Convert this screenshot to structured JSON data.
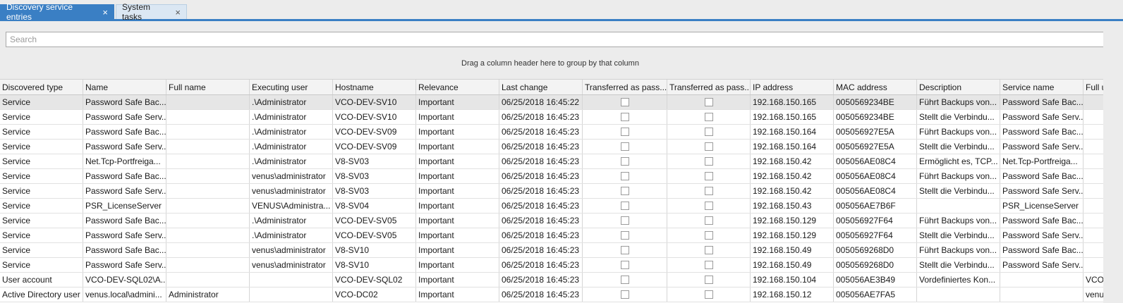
{
  "tabs": [
    {
      "label": "Discovery service entries",
      "close": "×"
    },
    {
      "label": "System tasks",
      "close": "×"
    }
  ],
  "search": {
    "placeholder": "Search",
    "value": ""
  },
  "group_hint": "Drag a column header here to group by that column",
  "columns": [
    "Discovered type",
    "Name",
    "Full name",
    "Executing user",
    "Hostname",
    "Relevance",
    "Last change",
    "Transferred as pass...",
    "Transferred as pass...",
    "IP address",
    "MAC address",
    "Description",
    "Service name",
    "Full u"
  ],
  "rows": [
    [
      "Service",
      "Password Safe Bac...",
      "",
      ".\\Administrator",
      "VCO-DEV-SV10",
      "Important",
      "06/25/2018 16:45:22",
      false,
      false,
      "192.168.150.165",
      "0050569234BE",
      "Führt Backups von...",
      "Password Safe Bac...",
      ""
    ],
    [
      "Service",
      "Password Safe Serv...",
      "",
      ".\\Administrator",
      "VCO-DEV-SV10",
      "Important",
      "06/25/2018 16:45:23",
      false,
      false,
      "192.168.150.165",
      "0050569234BE",
      "Stellt die Verbindu...",
      "Password Safe Serv...",
      ""
    ],
    [
      "Service",
      "Password Safe Bac...",
      "",
      ".\\Administrator",
      "VCO-DEV-SV09",
      "Important",
      "06/25/2018 16:45:23",
      false,
      false,
      "192.168.150.164",
      "005056927E5A",
      "Führt Backups von...",
      "Password Safe Bac...",
      ""
    ],
    [
      "Service",
      "Password Safe Serv...",
      "",
      ".\\Administrator",
      "VCO-DEV-SV09",
      "Important",
      "06/25/2018 16:45:23",
      false,
      false,
      "192.168.150.164",
      "005056927E5A",
      "Stellt die Verbindu...",
      "Password Safe Serv...",
      ""
    ],
    [
      "Service",
      "Net.Tcp-Portfreiga...",
      "",
      ".\\Administrator",
      "V8-SV03",
      "Important",
      "06/25/2018 16:45:23",
      false,
      false,
      "192.168.150.42",
      "005056AE08C4",
      "Ermöglicht es, TCP...",
      "Net.Tcp-Portfreiga...",
      ""
    ],
    [
      "Service",
      "Password Safe Bac...",
      "",
      "venus\\administrator",
      "V8-SV03",
      "Important",
      "06/25/2018 16:45:23",
      false,
      false,
      "192.168.150.42",
      "005056AE08C4",
      "Führt Backups von...",
      "Password Safe Bac...",
      ""
    ],
    [
      "Service",
      "Password Safe Serv...",
      "",
      "venus\\administrator",
      "V8-SV03",
      "Important",
      "06/25/2018 16:45:23",
      false,
      false,
      "192.168.150.42",
      "005056AE08C4",
      "Stellt die Verbindu...",
      "Password Safe Serv...",
      ""
    ],
    [
      "Service",
      "PSR_LicenseServer",
      "",
      "VENUS\\Administra...",
      "V8-SV04",
      "Important",
      "06/25/2018 16:45:23",
      false,
      false,
      "192.168.150.43",
      "005056AE7B6F",
      "",
      "PSR_LicenseServer",
      ""
    ],
    [
      "Service",
      "Password Safe Bac...",
      "",
      ".\\Administrator",
      "VCO-DEV-SV05",
      "Important",
      "06/25/2018 16:45:23",
      false,
      false,
      "192.168.150.129",
      "005056927F64",
      "Führt Backups von...",
      "Password Safe Bac...",
      ""
    ],
    [
      "Service",
      "Password Safe Serv...",
      "",
      ".\\Administrator",
      "VCO-DEV-SV05",
      "Important",
      "06/25/2018 16:45:23",
      false,
      false,
      "192.168.150.129",
      "005056927F64",
      "Stellt die Verbindu...",
      "Password Safe Serv...",
      ""
    ],
    [
      "Service",
      "Password Safe Bac...",
      "",
      "venus\\administrator",
      "V8-SV10",
      "Important",
      "06/25/2018 16:45:23",
      false,
      false,
      "192.168.150.49",
      "0050569268D0",
      "Führt Backups von...",
      "Password Safe Bac...",
      ""
    ],
    [
      "Service",
      "Password Safe Serv...",
      "",
      "venus\\administrator",
      "V8-SV10",
      "Important",
      "06/25/2018 16:45:23",
      false,
      false,
      "192.168.150.49",
      "0050569268D0",
      "Stellt die Verbindu...",
      "Password Safe Serv...",
      ""
    ],
    [
      "User account",
      "VCO-DEV-SQL02\\A...",
      "",
      "",
      "VCO-DEV-SQL02",
      "Important",
      "06/25/2018 16:45:23",
      false,
      false,
      "192.168.150.104",
      "005056AE3B49",
      "Vordefiniertes Kon...",
      "",
      "VCO"
    ],
    [
      "Active Directory user",
      "venus.local\\admini...",
      "Administrator",
      "",
      "VCO-DC02",
      "Important",
      "06/25/2018 16:45:23",
      false,
      false,
      "192.168.150.12",
      "005056AE7FA5",
      "",
      "",
      "venu"
    ]
  ]
}
